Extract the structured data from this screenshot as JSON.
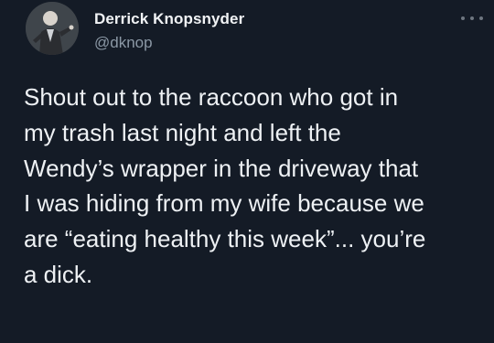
{
  "author": {
    "display_name": "Derrick Knopsnyder",
    "handle": "@dknop",
    "avatar_icon": "avatar-photo-icon"
  },
  "menu": {
    "icon": "more-horizontal-icon"
  },
  "tweet": {
    "lines": [
      "Shout out to the raccoon who got in",
      "my trash last night and left the",
      "Wendy’s wrapper in the driveway that",
      "I was hiding from my wife because we",
      "are “eating healthy this week”... you’re",
      "a dick."
    ]
  },
  "colors": {
    "background": "#141b26",
    "text": "#eef1f4",
    "secondary_text": "#8b98a5"
  }
}
